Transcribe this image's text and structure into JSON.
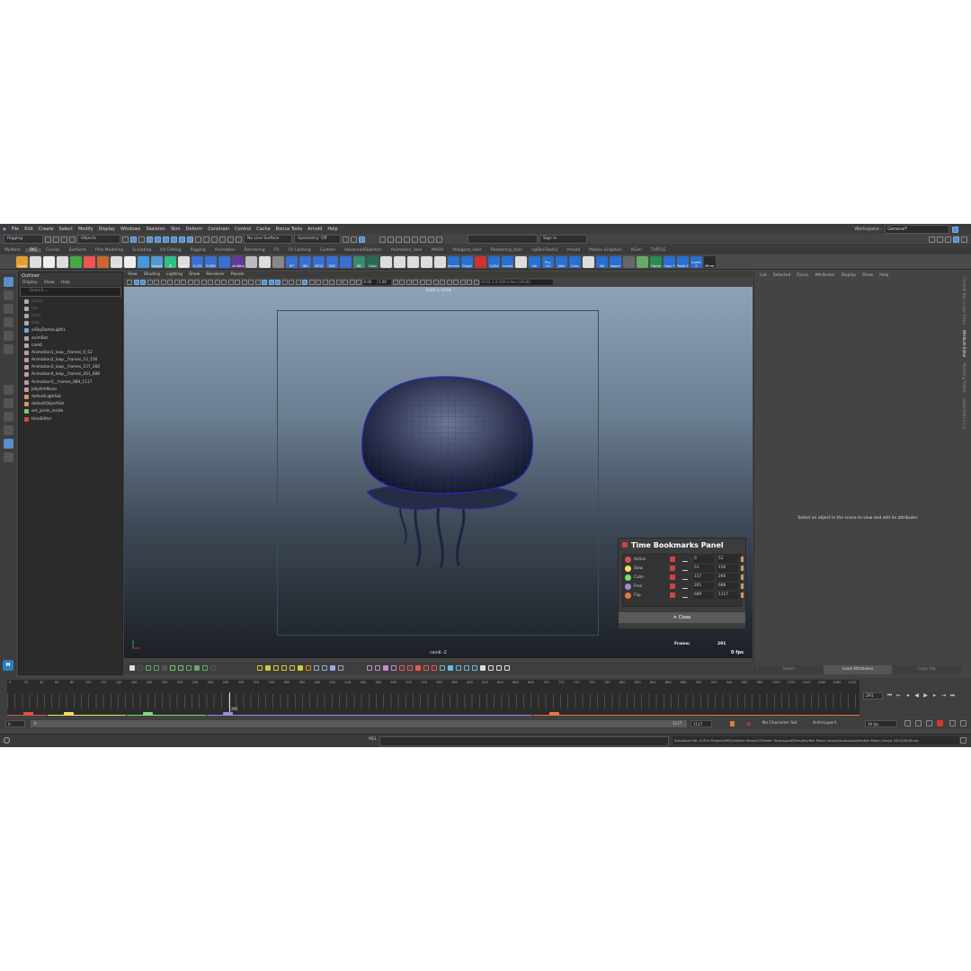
{
  "menubar": [
    "File",
    "Edit",
    "Create",
    "Select",
    "Modify",
    "Display",
    "Windows",
    "Skeleton",
    "Skin",
    "Deform",
    "Constrain",
    "Control",
    "Cache",
    "Bonus Tools",
    "Arnold",
    "Help"
  ],
  "workspace": {
    "label": "Workspace :",
    "value": "General*"
  },
  "status": {
    "mode": "Rigging",
    "objects": "Objects",
    "live_surface": "No Live Surface",
    "symmetry": "Symmetry: Off",
    "sign_in": "Sign In"
  },
  "shelf_tabs": [
    "MyWork",
    "RIG",
    "Curves",
    "Surfaces",
    "Poly Modeling",
    "Sculpting",
    "UV Editing",
    "Rigging",
    "Animation",
    "Rendering",
    "FX",
    "FX Caching",
    "Custom",
    "AdvancedSkeleton",
    "Animation_User",
    "MASH",
    "Polygons_User",
    "Rendering_User",
    "ngSkinTools2",
    "Arnold",
    "Motion Graphics",
    "XGen",
    "TURTLE"
  ],
  "shelf_active": "RIG",
  "shelf_labels": [
    "Count",
    "",
    "",
    "",
    "",
    "",
    "",
    "CTRLs",
    "",
    "",
    "Unpart",
    "JR",
    "D-PG",
    "D-CN",
    "D-PAR",
    "",
    "ctrlAttrs",
    "",
    "",
    "",
    "HIT",
    "INS",
    "WT-B",
    "MAT",
    "",
    "IBC",
    "Color",
    "",
    "",
    "",
    "",
    "",
    "homme",
    "Graph",
    "",
    "CySld",
    "curves",
    "",
    "No",
    "Pro-Ctrl",
    "Jolts",
    "Cons",
    "",
    "Vol",
    "export",
    "",
    "",
    "Opmo",
    "Copy S",
    "Paste S",
    "Invert S",
    "Mirror"
  ],
  "outliner": {
    "title": "Outliner",
    "menu": [
      "Display",
      "Show",
      "Help"
    ],
    "search": "Search...",
    "items": [
      {
        "label": "persp",
        "dim": true,
        "icon": "cam"
      },
      {
        "label": "top",
        "dim": true,
        "icon": "cam"
      },
      {
        "label": "front",
        "dim": true,
        "icon": "cam"
      },
      {
        "label": "side",
        "dim": true,
        "icon": "cam"
      },
      {
        "label": "aiSkyDomeLight1",
        "dim": false,
        "icon": "ln"
      },
      {
        "label": "animBot",
        "dim": false,
        "icon": "grp"
      },
      {
        "label": "cam6",
        "dim": false,
        "icon": "cam"
      },
      {
        "label": "Animation1_loop__frames_0_52",
        "dim": false,
        "icon": "grp"
      },
      {
        "label": "Animation2_loop__frames_53_156",
        "dim": false,
        "icon": "grp"
      },
      {
        "label": "Animation3_loop__frames_157_260",
        "dim": false,
        "icon": "grp"
      },
      {
        "label": "Animation4_loop__frames_261_688",
        "dim": false,
        "icon": "grp"
      },
      {
        "label": "Animation5__frames_689_1117",
        "dim": false,
        "icon": "grp"
      },
      {
        "label": "JellyfishMoon",
        "dim": false,
        "icon": "grp"
      },
      {
        "label": "defaultLightSet",
        "dim": false,
        "icon": "set"
      },
      {
        "label": "defaultObjectSet",
        "dim": false,
        "icon": "set"
      },
      {
        "label": "set_joints_inside",
        "dim": false,
        "icon": "jnt"
      },
      {
        "label": "timeEditor",
        "dim": false,
        "icon": "tm"
      }
    ]
  },
  "viewport": {
    "menu": [
      "View",
      "Shading",
      "Lighting",
      "Show",
      "Renderer",
      "Panels"
    ],
    "fields": [
      "0.00",
      "1.00"
    ],
    "color_space": "ACES 1.0 SDR-video (sRGB)",
    "resolution": "1024 x 1024",
    "camera": "cam6 -Z",
    "frame_label": "Frame:",
    "frame_value": "291",
    "fps": "0 fps"
  },
  "bookmarks": {
    "title": "Time Bookmarks Panel",
    "rows": [
      {
        "name": "Active",
        "start": "0",
        "end": "52",
        "color": "#d9534f"
      },
      {
        "name": "Slow",
        "start": "53",
        "end": "156",
        "color": "#f0e060"
      },
      {
        "name": "Calm",
        "start": "157",
        "end": "260",
        "color": "#7ddc72"
      },
      {
        "name": "Free",
        "start": "261",
        "end": "688",
        "color": "#9a8ce0"
      },
      {
        "name": "Flip",
        "start": "689",
        "end": "1117",
        "color": "#e8793a"
      }
    ],
    "close": "Close"
  },
  "attribute_editor": {
    "menu": [
      "List",
      "Selected",
      "Focus",
      "Attributes",
      "Display",
      "Show",
      "Help"
    ],
    "message": "Select an object in the scene to view and edit its attributes",
    "buttons": [
      "Select",
      "Load Attributes",
      "Copy Tab"
    ]
  },
  "right_tabs": [
    "Channel Box / Layer Editor",
    "Attribute Editor",
    "Modeling Toolkit",
    "ngSkinTools 2.1.0"
  ],
  "timeline": {
    "ticks": [
      "0",
      "20",
      "40",
      "60",
      "80",
      "100",
      "120",
      "140",
      "160",
      "180",
      "200",
      "220",
      "240",
      "260",
      "280",
      "300",
      "320",
      "340",
      "360",
      "380",
      "400",
      "420",
      "440",
      "460",
      "480",
      "500",
      "520",
      "540",
      "560",
      "580",
      "600",
      "620",
      "640",
      "660",
      "680",
      "700",
      "720",
      "740",
      "760",
      "780",
      "800",
      "820",
      "840",
      "860",
      "880",
      "900",
      "920",
      "940",
      "960",
      "980",
      "1000",
      "1020",
      "1040",
      "1060",
      "1080",
      "1100"
    ],
    "current": "291",
    "max": 1117,
    "current_frame": 291,
    "frame_field": "291"
  },
  "range": {
    "start": "0",
    "inner_start": "0",
    "inner_end": "1117",
    "end": "1117",
    "character": "No Character Set",
    "anim_layer": "AnimLayer1",
    "fps": "30 fps"
  },
  "cmd": {
    "mel": "MEL",
    "help": "AutoSave file: H:/Full Projects/PRJ Jellyfish Moon/CGTrader Turbosquid/Files/Jellyfish Moon (maya)/autosave/Jellyfish Moon (maya 2022)0006.ma"
  }
}
